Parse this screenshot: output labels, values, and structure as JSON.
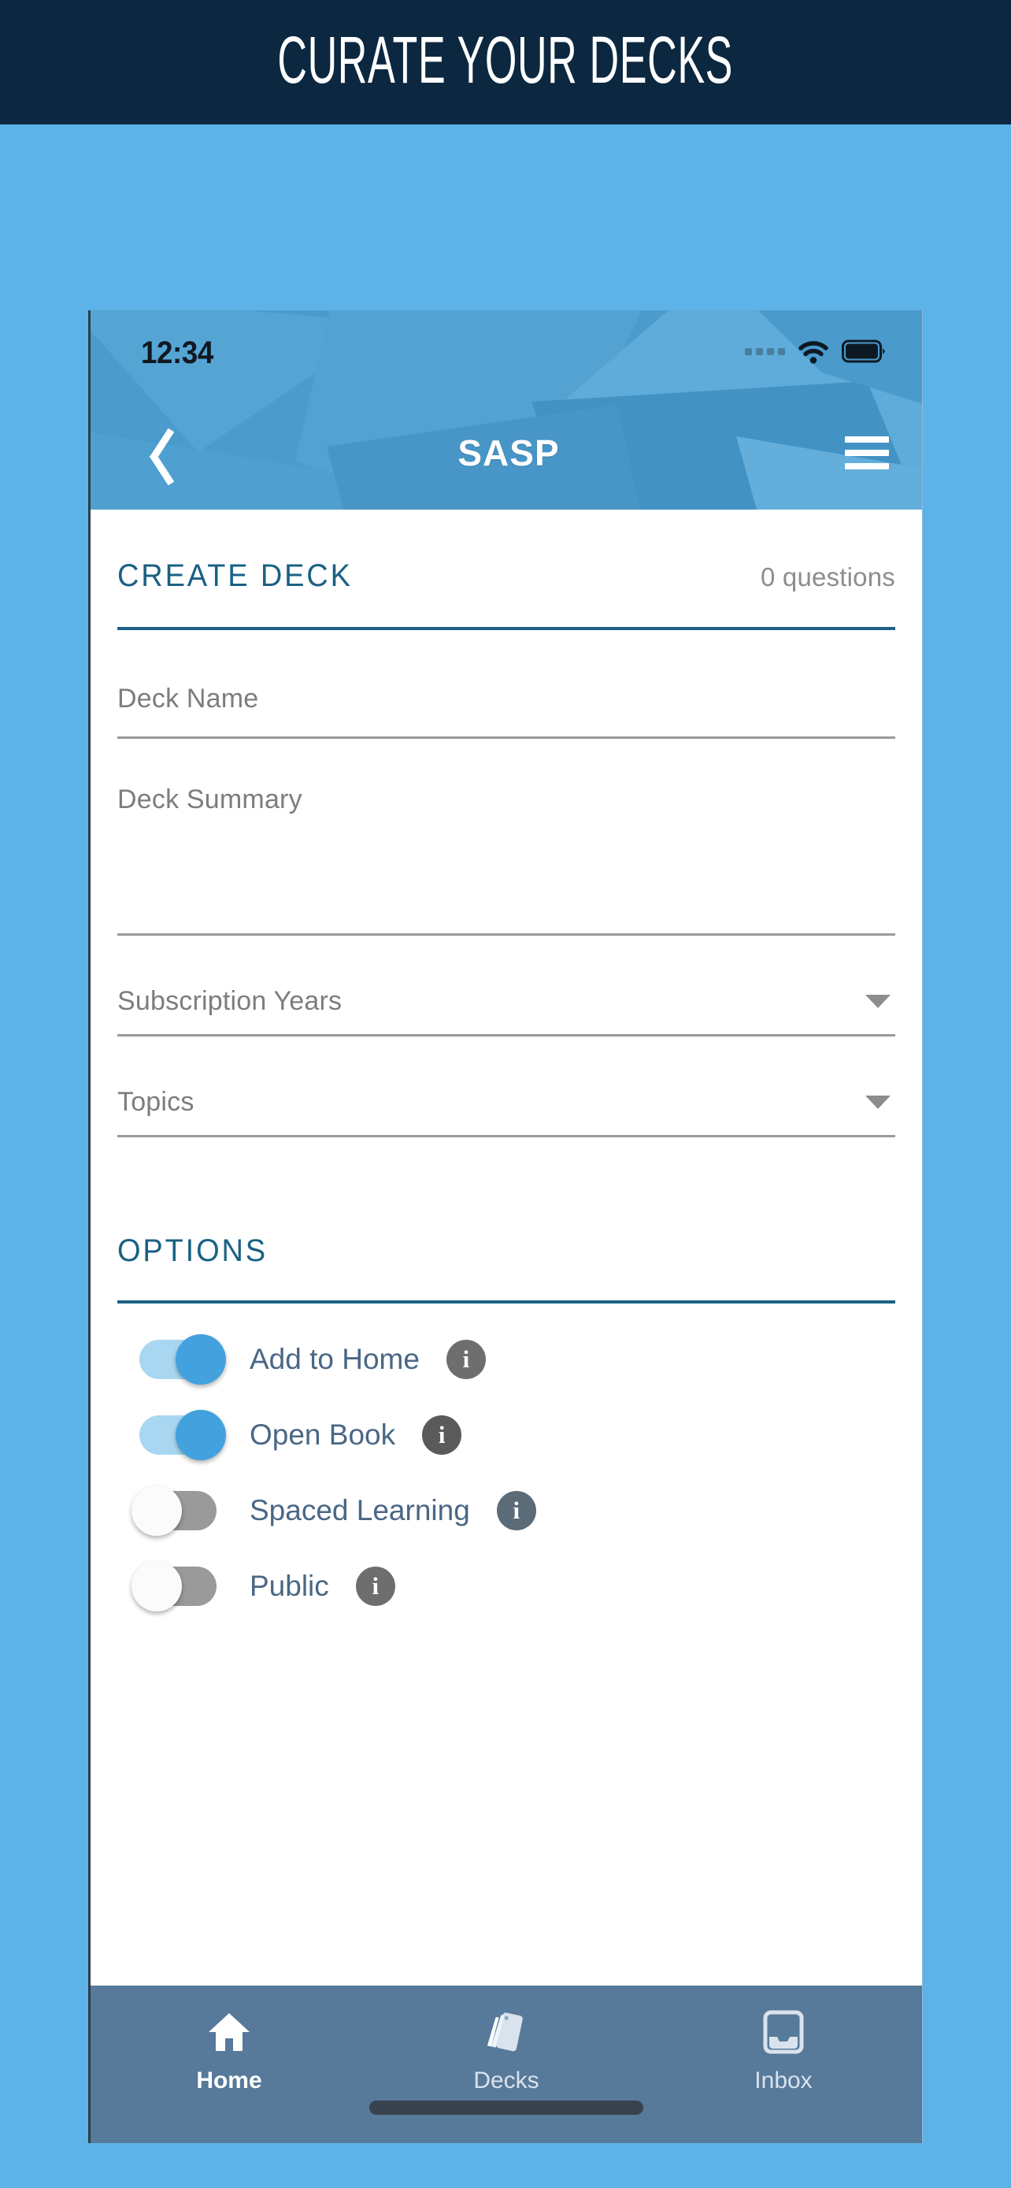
{
  "banner": {
    "title": "CURATE YOUR DECKS",
    "background_color": "#0c2840",
    "text_color": "#ffffff"
  },
  "page_background_color": "#5db3e8",
  "phone": {
    "status_bar": {
      "time": "12:34",
      "signal_icon": "signal-dots-icon",
      "wifi_icon": "wifi-icon",
      "battery_icon": "battery-full-icon"
    },
    "app_bar": {
      "back_icon": "back-chevron-icon",
      "title": "SASP",
      "menu_icon": "hamburger-menu-icon",
      "background_color": "#4b9ccd"
    },
    "create_deck": {
      "section_title": "CREATE DECK",
      "question_count": "0 questions",
      "accent_color": "#1a6184",
      "fields": {
        "deck_name": {
          "placeholder": "Deck Name",
          "value": ""
        },
        "deck_summary": {
          "placeholder": "Deck Summary",
          "value": ""
        },
        "subscription_years": {
          "placeholder": "Subscription Years",
          "value": "",
          "caret_icon": "chevron-down-icon"
        },
        "topics": {
          "placeholder": "Topics",
          "value": "",
          "caret_icon": "chevron-down-icon"
        }
      }
    },
    "options": {
      "section_title": "OPTIONS",
      "toggle_on_color": "#43a2de",
      "toggle_off_color": "#9a9a9a",
      "items": [
        {
          "label": "Add to Home",
          "state": "on",
          "info_icon": "info-icon"
        },
        {
          "label": "Open Book",
          "state": "on",
          "info_icon": "info-icon"
        },
        {
          "label": "Spaced Learning",
          "state": "off",
          "info_icon": "info-icon"
        },
        {
          "label": "Public",
          "state": "off",
          "info_icon": "info-icon"
        }
      ]
    },
    "tab_bar": {
      "background_color": "#57799a",
      "tabs": [
        {
          "label": "Home",
          "icon": "home-icon",
          "active": true
        },
        {
          "label": "Decks",
          "icon": "cards-icon",
          "active": false
        },
        {
          "label": "Inbox",
          "icon": "inbox-icon",
          "active": false
        }
      ],
      "home_indicator": "home-indicator-bar"
    }
  }
}
